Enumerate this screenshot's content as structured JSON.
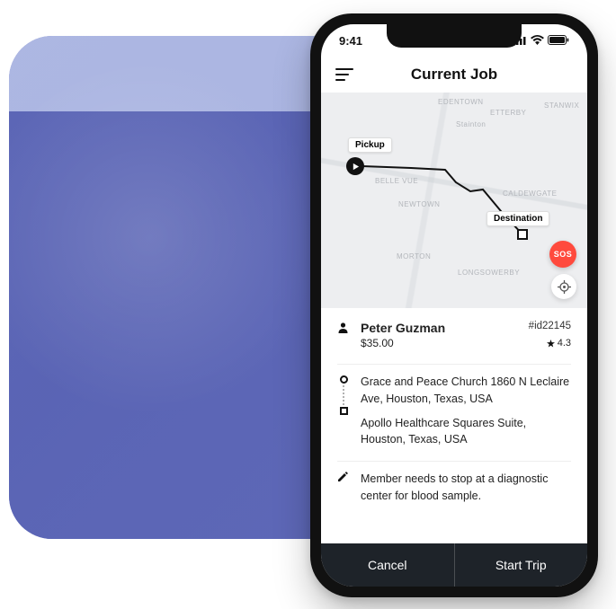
{
  "statusbar": {
    "time": "9:41"
  },
  "header": {
    "title": "Current Job"
  },
  "map": {
    "pickup_label": "Pickup",
    "destination_label": "Destination",
    "sos_label": "SOS",
    "places": {
      "edentown": "EDENTOWN",
      "etterby": "ETTERBY",
      "stanwix": "STANWIX",
      "stainton": "Stainton",
      "bellevue": "BELLE VUE",
      "newtown": "NEWTOWN",
      "caldewgate": "CALDEWGATE",
      "morton": "MORTON",
      "longsowerby": "LONGSOWERBY"
    }
  },
  "member": {
    "name": "Peter Guzman",
    "id": "#id22145",
    "price": "$35.00",
    "rating": "4.3"
  },
  "addresses": {
    "pickup": "Grace and Peace Church 1860 N Leclaire Ave, Houston, Texas, USA",
    "destination": "Apollo Healthcare Squares Suite, Houston, Texas, USA"
  },
  "note": "Member needs to stop at a diagnostic center for blood sample.",
  "footer": {
    "cancel": "Cancel",
    "start": "Start Trip"
  }
}
